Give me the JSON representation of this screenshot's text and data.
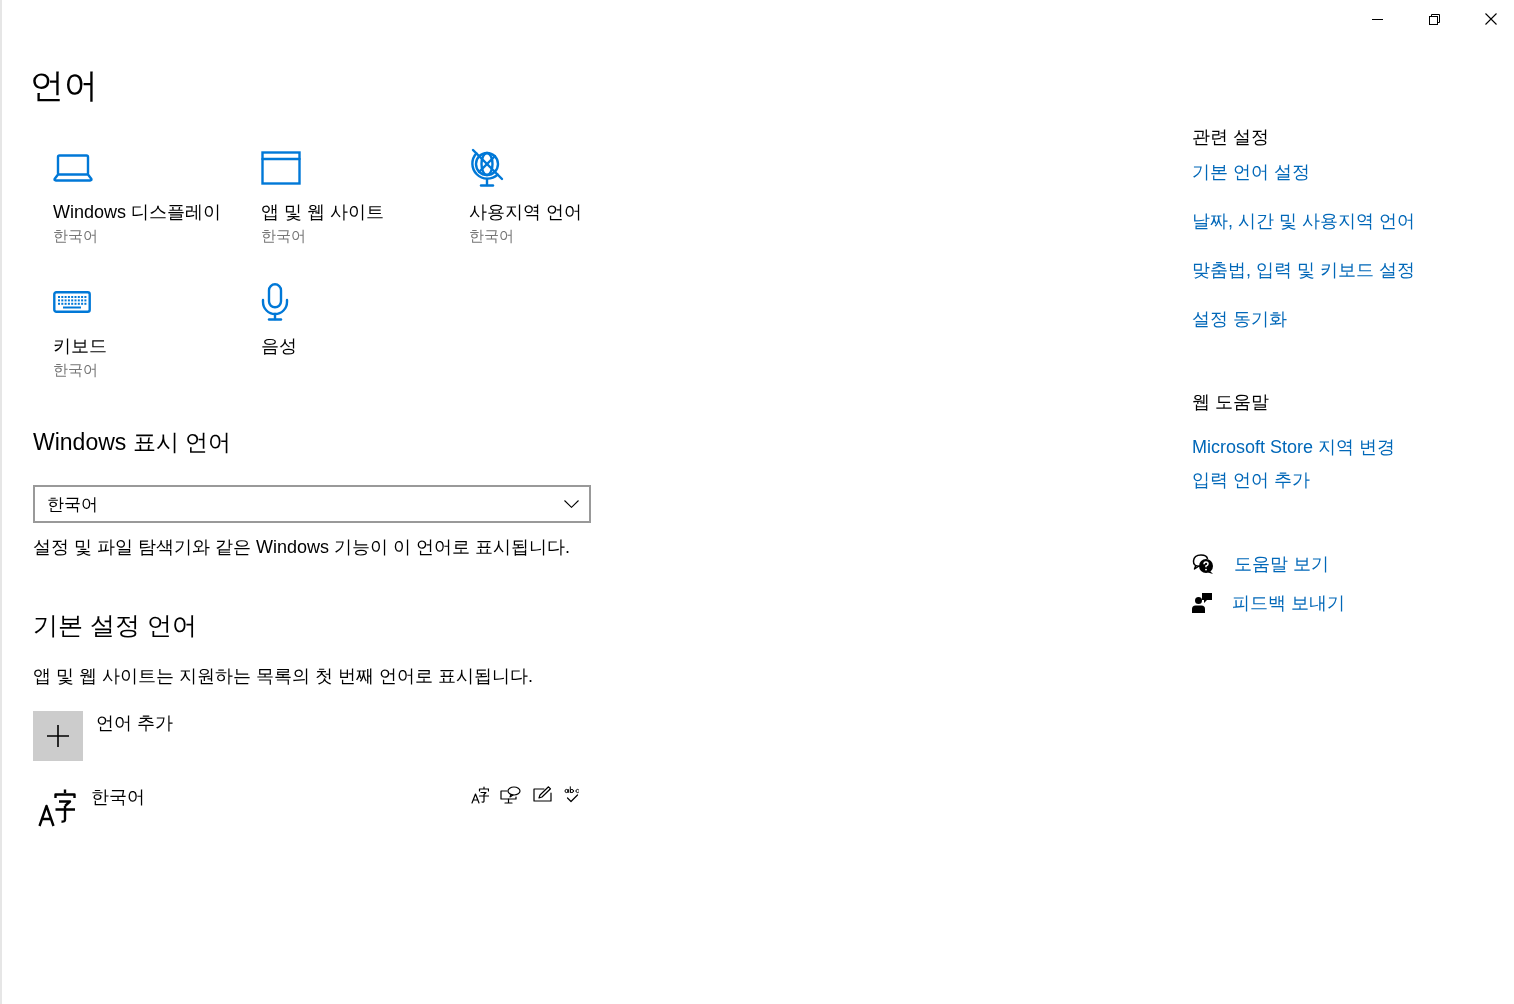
{
  "page_title": "언어",
  "tiles": [
    {
      "label": "Windows 디스플레이",
      "value": "한국어"
    },
    {
      "label": "앱 및 웹 사이트",
      "value": "한국어"
    },
    {
      "label": "사용지역 언어",
      "value": "한국어"
    },
    {
      "label": "키보드",
      "value": "한국어"
    },
    {
      "label": "음성"
    }
  ],
  "display_language": {
    "heading": "Windows 표시 언어",
    "dropdown": {
      "value": "한국어"
    },
    "description": "설정 및 파일 탐색기와 같은 Windows 기능이 이 언어로 표시됩니다."
  },
  "preferred_languages": {
    "heading": "기본 설정 언어",
    "description": "앱 및 웹 사이트는 지원하는 목록의 첫 번째 언어로 표시됩니다.",
    "add_button": "언어 추가",
    "languages": [
      {
        "name": "한국어"
      }
    ]
  },
  "related_settings": {
    "heading": "관련 설정",
    "links": [
      "기본 언어 설정",
      "날짜, 시간 및 사용지역 언어",
      "맞춤법, 입력 및 키보드 설정",
      "설정 동기화"
    ]
  },
  "web_help": {
    "heading": "웹 도움말",
    "links": [
      "Microsoft Store 지역 변경",
      "입력 언어 추가"
    ]
  },
  "support_links": [
    {
      "label": "도움말 보기"
    },
    {
      "label": "피드백 보내기"
    }
  ]
}
